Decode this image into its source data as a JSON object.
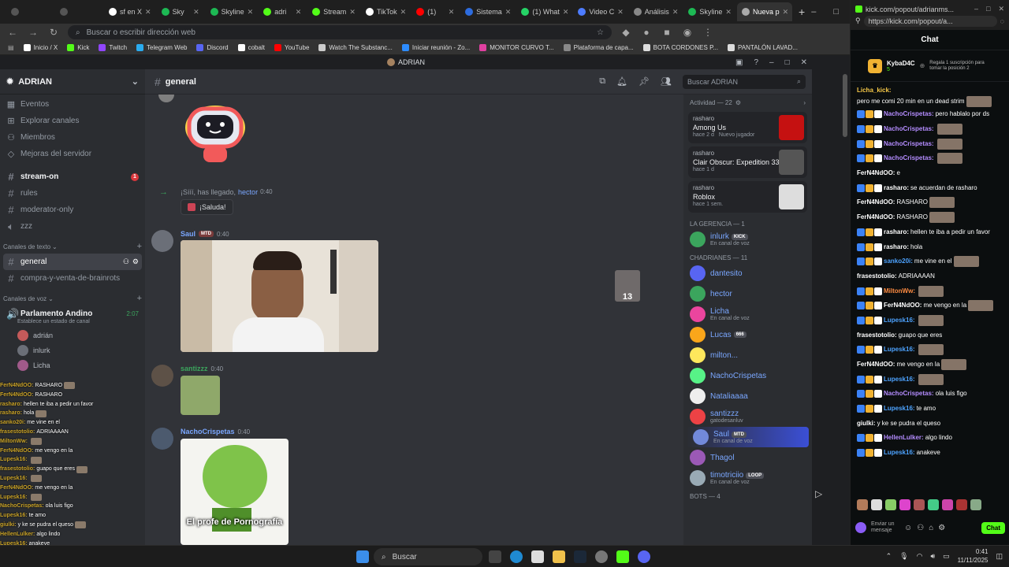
{
  "browser": {
    "tabs": [
      {
        "label": "",
        "color": "#555"
      },
      {
        "label": "",
        "color": "#555"
      },
      {
        "label": "sf en X",
        "color": "#fff"
      },
      {
        "label": "Sky",
        "color": "#1db954"
      },
      {
        "label": "Skyline",
        "color": "#1db954"
      },
      {
        "label": "adri",
        "color": "#53fc18"
      },
      {
        "label": "Stream",
        "color": "#53fc18"
      },
      {
        "label": "TikTok",
        "color": "#fff"
      },
      {
        "label": "(1)",
        "color": "#ff0000"
      },
      {
        "label": "Sistema",
        "color": "#2d6cdf"
      },
      {
        "label": "(1) What",
        "color": "#25d366"
      },
      {
        "label": "Video C",
        "color": "#4d7cff"
      },
      {
        "label": "Análisis",
        "color": "#888"
      },
      {
        "label": "Skyline",
        "color": "#1db954"
      },
      {
        "label": "Nueva p",
        "color": "#aaa",
        "active": true
      }
    ],
    "omnibox_placeholder": "Buscar o escribir dirección web",
    "bookmarks": [
      {
        "label": "Inicio / X",
        "color": "#fff"
      },
      {
        "label": "Kick",
        "color": "#53fc18"
      },
      {
        "label": "Twitch",
        "color": "#9146ff"
      },
      {
        "label": "Telegram Web",
        "color": "#2aabee"
      },
      {
        "label": "Discord",
        "color": "#5865f2"
      },
      {
        "label": "cobalt",
        "color": "#fff"
      },
      {
        "label": "YouTube",
        "color": "#ff0000"
      },
      {
        "label": "Watch The Substanc...",
        "color": "#ccc"
      },
      {
        "label": "Iniciar reunión - Zo...",
        "color": "#2d8cff"
      },
      {
        "label": "MONITOR CURVO T...",
        "color": "#e040a0"
      },
      {
        "label": "Plataforma de capa...",
        "color": "#888"
      },
      {
        "label": "BOTA CORDONES P...",
        "color": "#ddd"
      },
      {
        "label": "PANTALÓN LAVAD...",
        "color": "#ddd"
      }
    ]
  },
  "discord": {
    "window_title": "ADRIAN",
    "server_name": "ADRIAN",
    "nav": [
      {
        "label": "Eventos",
        "icon": "calendar-icon"
      },
      {
        "label": "Explorar canales",
        "icon": "browse-icon"
      },
      {
        "label": "Miembros",
        "icon": "members-icon"
      },
      {
        "label": "Mejoras del servidor",
        "icon": "boost-icon"
      }
    ],
    "top_channels": [
      {
        "label": "stream-on",
        "bold": true,
        "badge": "1"
      },
      {
        "label": "rules"
      },
      {
        "label": "moderator-only"
      },
      {
        "label": "zzz"
      }
    ],
    "text_category": "Canales de texto",
    "text_channels": [
      {
        "label": "general",
        "selected": true
      },
      {
        "label": "compra-y-venta-de-brainrots"
      }
    ],
    "voice_category": "Canales de voz",
    "voice_channel": {
      "label": "Parlamento Andino",
      "status": "Establece un estado de canal",
      "timer": "2:07"
    },
    "voice_members": [
      "adrián",
      "inlurk",
      "Licha"
    ],
    "channel_name": "general",
    "search_placeholder": "Buscar ADRIAN",
    "messages": {
      "welcome_text": "¡Sííí, has llegado,",
      "welcome_user": "hector",
      "welcome_time": "0:40",
      "wave_label": "¡Saluda!",
      "m1_user": "Saul",
      "m1_tag": "MTD",
      "m1_time": "0:40",
      "m2_user": "santizzz",
      "m2_time": "0:40",
      "m3_user": "NachoCrispetas",
      "m3_time": "0:40",
      "m3_caption": "El profe de Pornografía",
      "reaction_count": "13"
    },
    "activity_header": "Actividad — 22",
    "activities": [
      {
        "user": "rasharo",
        "game": "Among Us",
        "when": "hace 2 d",
        "extra": "Nuevo jugador",
        "color": "#c51111"
      },
      {
        "user": "rasharo",
        "game": "Clair Obscur: Expedition 33",
        "when": "hace 1 d",
        "extra": "",
        "color": "#555"
      },
      {
        "user": "rasharo",
        "game": "Roblox",
        "when": "hace 1 sem.",
        "extra": "",
        "color": "#ddd"
      }
    ],
    "group1": "LA GERENCIA — 1",
    "group1_members": [
      {
        "name": "inlurk",
        "sub": "En canal de voz",
        "tag": "KICK",
        "color": "#3ba55d"
      }
    ],
    "group2": "CHADRIANES — 11",
    "group2_members": [
      {
        "name": "dantesito",
        "sub": "",
        "color": "#5865f2"
      },
      {
        "name": "hector",
        "sub": "",
        "color": "#3ba55d"
      },
      {
        "name": "Licha",
        "sub": "En canal de voz",
        "color": "#eb459e"
      },
      {
        "name": "Lucas",
        "sub": "",
        "tag": "666",
        "color": "#faa61a"
      },
      {
        "name": "milton...",
        "sub": "",
        "color": "#fee75c"
      },
      {
        "name": "NachoCrispetas",
        "sub": "",
        "color": "#57f287"
      },
      {
        "name": "Nataliaaaa",
        "sub": "",
        "color": "#eeeeee"
      },
      {
        "name": "santizzz",
        "sub": "gatodesanluv",
        "color": "#ed4245"
      },
      {
        "name": "Saul",
        "sub": "En canal de voz",
        "tag": "MTD",
        "color": "#7289da"
      },
      {
        "name": "Thagol",
        "sub": "",
        "color": "#9b59b6"
      },
      {
        "name": "timotriciio",
        "sub": "En canal de voz",
        "tag": "LOOP",
        "color": "#99aab5"
      }
    ],
    "group3": "BOTS — 4"
  },
  "overlay_chat": [
    {
      "user": "FerN4NdOO:",
      "text": "RASHARO"
    },
    {
      "user": "FerN4NdOO:",
      "text": "RASHARO"
    },
    {
      "user": "rasharo:",
      "text": "hellen te iba a pedir un favor"
    },
    {
      "user": "rasharo:",
      "text": "hola"
    },
    {
      "user": "sanko20i:",
      "text": "me vine en el"
    },
    {
      "user": "frasestotolio:",
      "text": "ADRIAAAAN"
    },
    {
      "user": "MiltonWw:",
      "text": ""
    },
    {
      "user": "FerN4NdOO:",
      "text": "me vengo en la"
    },
    {
      "user": "Lupesk16:",
      "text": ""
    },
    {
      "user": "frasestotolio:",
      "text": "guapo que eres"
    },
    {
      "user": "Lupesk16:",
      "text": ""
    },
    {
      "user": "FerN4NdOO:",
      "text": "me vengo en la"
    },
    {
      "user": "Lupesk16:",
      "text": ""
    },
    {
      "user": "NachoCrispetas:",
      "text": "ola luis figo"
    },
    {
      "user": "Lupesk16:",
      "text": "te amo"
    },
    {
      "user": "giulki:",
      "text": "y ke se pudra el queso"
    },
    {
      "user": "HellenLulker:",
      "text": "algo lindo"
    },
    {
      "user": "Lupesk16:",
      "text": "anakeve"
    }
  ],
  "kick": {
    "url_title": "kick.com/popout/adrianms...",
    "url": "https://kick.com/popout/a...",
    "header": "Chat",
    "pinned_user": "KybaD4C",
    "pinned_rank": "5",
    "pinned_desc": "Regala 1 suscripción para tomar la posición 2",
    "input_placeholder": "Enviar un mensaje",
    "send_label": "Chat",
    "messages": [
      {
        "user": "Licha_kick:",
        "text": "pero me comi 20 min en un dead strim",
        "color": "#f7c948",
        "emote": true
      },
      {
        "user": "NachoCrispetas:",
        "text": "pero hablalo por ds",
        "color": "#b48cff"
      },
      {
        "user": "NachoCrispetas:",
        "text": "",
        "color": "#b48cff",
        "emote": true
      },
      {
        "user": "NachoCrispetas:",
        "text": "",
        "color": "#b48cff",
        "emote": true
      },
      {
        "user": "NachoCrispetas:",
        "text": "",
        "color": "#b48cff",
        "emote": true
      },
      {
        "user": "FerN4NdOO:",
        "text": "e",
        "color": "#ffffff"
      },
      {
        "user": "rasharo:",
        "text": "se acuerdan de rasharo",
        "color": "#ffffff"
      },
      {
        "user": "FerN4NdOO:",
        "text": "RASHARO",
        "color": "#ffffff",
        "emote": true
      },
      {
        "user": "FerN4NdOO:",
        "text": "RASHARO",
        "color": "#ffffff",
        "emote": true
      },
      {
        "user": "rasharo:",
        "text": "hellen te iba a pedir un favor",
        "color": "#ffffff"
      },
      {
        "user": "rasharo:",
        "text": "hola",
        "color": "#ffffff"
      },
      {
        "user": "sanko20i:",
        "text": "me vine en el",
        "color": "#4da3ff",
        "emote": true
      },
      {
        "user": "frasestotolio:",
        "text": "ADRIAAAAN",
        "color": "#ffffff"
      },
      {
        "user": "MiltonWw:",
        "text": "",
        "color": "#ff8c42",
        "emote": true
      },
      {
        "user": "FerN4NdOO:",
        "text": "me vengo en la",
        "color": "#ffffff",
        "emote": true
      },
      {
        "user": "Lupesk16:",
        "text": "",
        "color": "#4da3ff",
        "emote": true
      },
      {
        "user": "frasestotolio:",
        "text": "guapo que eres",
        "color": "#ffffff"
      },
      {
        "user": "Lupesk16:",
        "text": "",
        "color": "#4da3ff",
        "emote": true
      },
      {
        "user": "FerN4NdOO:",
        "text": "me vengo en la",
        "color": "#ffffff",
        "emote": true
      },
      {
        "user": "Lupesk16:",
        "text": "",
        "color": "#4da3ff",
        "emote": true
      },
      {
        "user": "NachoCrispetas:",
        "text": "ola luis figo",
        "color": "#b48cff"
      },
      {
        "user": "Lupesk16:",
        "text": "te amo",
        "color": "#4da3ff"
      },
      {
        "user": "giulki:",
        "text": "y ke se pudra el queso",
        "color": "#ffffff"
      },
      {
        "user": "HellenLulker:",
        "text": "algo lindo",
        "color": "#b48cff"
      },
      {
        "user": "Lupesk16:",
        "text": "anakeve",
        "color": "#4da3ff"
      }
    ]
  },
  "taskbar": {
    "search_label": "Buscar",
    "time": "0:41",
    "date": "11/11/2025"
  }
}
